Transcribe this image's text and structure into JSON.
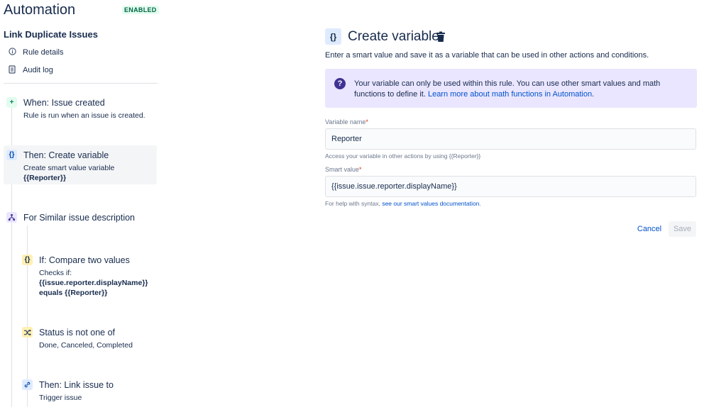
{
  "app": {
    "title": "Automation",
    "status_badge": "ENABLED"
  },
  "rule": {
    "name": "Link Duplicate Issues"
  },
  "nav": [
    {
      "label": "Rule details",
      "icon": "info-icon"
    },
    {
      "label": "Audit log",
      "icon": "document-icon"
    }
  ],
  "components": {
    "trigger": {
      "title": "When: Issue created",
      "desc": "Rule is run when an issue is created.",
      "icon": "plus-icon"
    },
    "create_var": {
      "title": "Then: Create variable",
      "desc_line1": "Create smart value variable",
      "desc_line2": "{{Reporter}}",
      "icon": "braces-icon"
    },
    "branch": {
      "title": "For Similar issue description",
      "icon": "branch-icon"
    },
    "compare": {
      "title": "If: Compare two values",
      "desc_line1": "Checks if:",
      "desc_line2": "{{issue.reporter.displayName}}",
      "desc_line3": "equals {{Reporter}}",
      "icon": "braces-icon"
    },
    "status": {
      "title": "Status is not one of",
      "desc": "Done, Canceled, Completed",
      "icon": "shuffle-icon"
    },
    "link": {
      "title": "Then: Link issue to",
      "desc": "Trigger issue",
      "icon": "link-icon"
    }
  },
  "panel": {
    "title": "Create variable",
    "icon_glyph": "{}",
    "intro": "Enter a smart value and save it as a variable that can be used in other actions and conditions.",
    "info_text": "Your variable can only be used within this rule. You can use other smart values and math functions to define it. ",
    "info_link": "Learn more about math functions in Automation",
    "info_end": ".",
    "variable_name_label": "Variable name",
    "variable_name_value": "Reporter",
    "variable_name_help": "Access your variable in other actions by using {{Reporter}}",
    "smart_value_label": "Smart value",
    "smart_value_value": "{{issue.issue.reporter.displayName}}",
    "smart_value_help": "For help with syntax, ",
    "smart_value_help_link": "see our smart values documentation",
    "smart_value_help_end": ".",
    "required_mark": "*",
    "cancel_label": "Cancel",
    "save_label": "Save"
  },
  "colors": {
    "accent": "#0052cc",
    "info_bg": "#eae6ff",
    "info_icon": "#403294",
    "badge_text": "#006644",
    "badge_bg": "#e3fcef"
  }
}
